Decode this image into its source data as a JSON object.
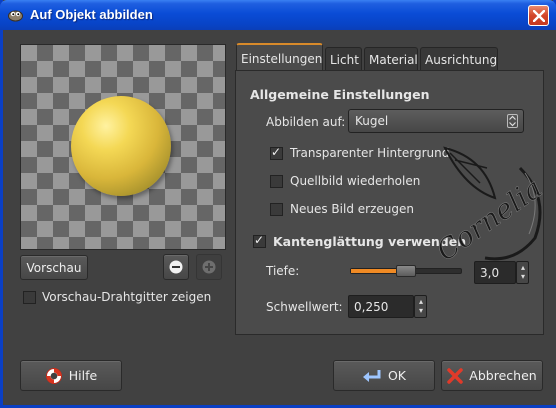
{
  "window": {
    "title": "Auf Objekt abbilden"
  },
  "preview": {
    "button_label": "Vorschau",
    "wireframe_checkbox_label": "Vorschau-Drahtgitter zeigen",
    "wireframe_checked": false
  },
  "tabs": [
    {
      "label": "Einstellungen",
      "active": true
    },
    {
      "label": "Licht",
      "active": false
    },
    {
      "label": "Material",
      "active": false
    },
    {
      "label": "Ausrichtung",
      "active": false
    }
  ],
  "settings": {
    "heading": "Allgemeine Einstellungen",
    "map_to_label": "Abbilden auf:",
    "map_to_value": "Kugel",
    "transparent_bg_label": "Transparenter Hintergrund",
    "transparent_bg_checked": true,
    "tile_source_label": "Quellbild wiederholen",
    "tile_source_checked": false,
    "new_image_label": "Neues Bild erzeugen",
    "new_image_checked": false,
    "antialias_label": "Kantenglättung verwenden",
    "antialias_checked": true,
    "depth_label": "Tiefe:",
    "depth_value": "3,0",
    "depth_slider_fraction": 0.5,
    "threshold_label": "Schwellwert:",
    "threshold_value": "0,250"
  },
  "buttons": {
    "help": "Hilfe",
    "ok": "OK",
    "cancel": "Abbrechen"
  },
  "watermark": {
    "text": "Cornelia"
  },
  "colors": {
    "title_bar": "#0a4cd6",
    "tab_accent": "#d88a2a",
    "slider_fill": "#f08a24",
    "sphere": "#f4d855"
  }
}
